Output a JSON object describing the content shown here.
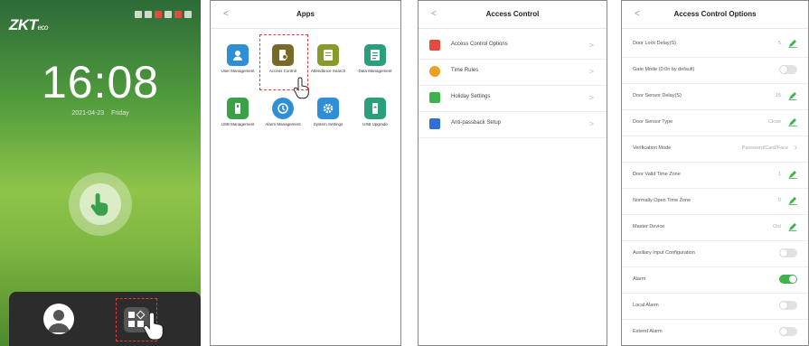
{
  "lock_screen": {
    "logo": "ZKT",
    "logo_suffix": "eco",
    "time": "16:08",
    "date": "2021-04-23 Friday"
  },
  "apps_screen": {
    "back": "<",
    "title": "Apps",
    "apps": [
      {
        "label": "User Management",
        "icon": "user-management-icon",
        "color": "#2f8fd6"
      },
      {
        "label": "Access Control",
        "icon": "access-control-icon",
        "color": "#7a6a2a"
      },
      {
        "label": "Attendance Search",
        "icon": "attendance-search-icon",
        "color": "#8a9a2a"
      },
      {
        "label": "Data Management",
        "icon": "data-management-icon",
        "color": "#2aa07a"
      },
      {
        "label": "USB Management",
        "icon": "usb-management-icon",
        "color": "#3ba04a"
      },
      {
        "label": "Alarm Management",
        "icon": "alarm-management-icon",
        "color": "#2f8fd6"
      },
      {
        "label": "System Settings",
        "icon": "system-settings-icon",
        "color": "#2f8fd6"
      },
      {
        "label": "USB Upgrade",
        "icon": "usb-upgrade-icon",
        "color": "#2aa07a"
      }
    ]
  },
  "access_control_screen": {
    "back": "<",
    "title": "Access Control",
    "items": [
      {
        "label": "Access Control Options",
        "color": "#e34b3c"
      },
      {
        "label": "Time Rules",
        "color": "#f0a020"
      },
      {
        "label": "Holiday Settings",
        "color": "#3bb54a"
      },
      {
        "label": "Anti-passback Setup",
        "color": "#2f6fd6"
      }
    ],
    "chevron": ">"
  },
  "options_screen": {
    "back": "<",
    "title": "Access Control Options",
    "rows": [
      {
        "label": "Door Lock Delay(S)",
        "value": "5",
        "control": "edit"
      },
      {
        "label": "Gate Mode (0:0n by default)",
        "value": "",
        "control": "toggle",
        "on": false
      },
      {
        "label": "Door Sensor Delay(S)",
        "value": "15",
        "control": "edit"
      },
      {
        "label": "Door Sensor Type",
        "value": "Close",
        "control": "edit"
      },
      {
        "label": "Verification Mode",
        "value": "Password/Card/Face",
        "control": "chevron"
      },
      {
        "label": "Door Valid Time Zone",
        "value": "1",
        "control": "edit"
      },
      {
        "label": "Normally Open Time Zone",
        "value": "0",
        "control": "edit"
      },
      {
        "label": "Master Device",
        "value": "Out",
        "control": "edit"
      },
      {
        "label": "Auxiliary Input Configuration",
        "value": "",
        "control": "toggle",
        "on": false
      },
      {
        "label": "Alarm",
        "value": "",
        "control": "toggle",
        "on": true
      },
      {
        "label": "Local Alarm",
        "value": "",
        "control": "toggle",
        "on": false
      },
      {
        "label": "Extend Alarm",
        "value": "",
        "control": "toggle",
        "on": false
      }
    ],
    "accent": "#3bb54a"
  }
}
